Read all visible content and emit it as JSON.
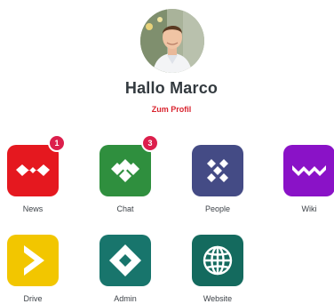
{
  "header": {
    "greeting": "Hallo Marco",
    "profile_link": "Zum Profil"
  },
  "apps": [
    {
      "label": "News",
      "icon": "news-logo-icon",
      "color": "#e5181f",
      "badge": "1"
    },
    {
      "label": "Chat",
      "icon": "chat-logo-icon",
      "color": "#2f8f3e",
      "badge": "3"
    },
    {
      "label": "People",
      "icon": "people-logo-icon",
      "color": "#444b85"
    },
    {
      "label": "Wiki",
      "icon": "wiki-logo-icon",
      "color": "#8a12c7"
    },
    {
      "label": "Drive",
      "icon": "drive-logo-icon",
      "color": "#f2c600"
    },
    {
      "label": "Admin",
      "icon": "admin-logo-icon",
      "color": "#18756c"
    },
    {
      "label": "Website",
      "icon": "globe-icon",
      "color": "#146a5e"
    }
  ],
  "colors": {
    "accent_red": "#d9232e",
    "badge": "#dc1f4c"
  }
}
